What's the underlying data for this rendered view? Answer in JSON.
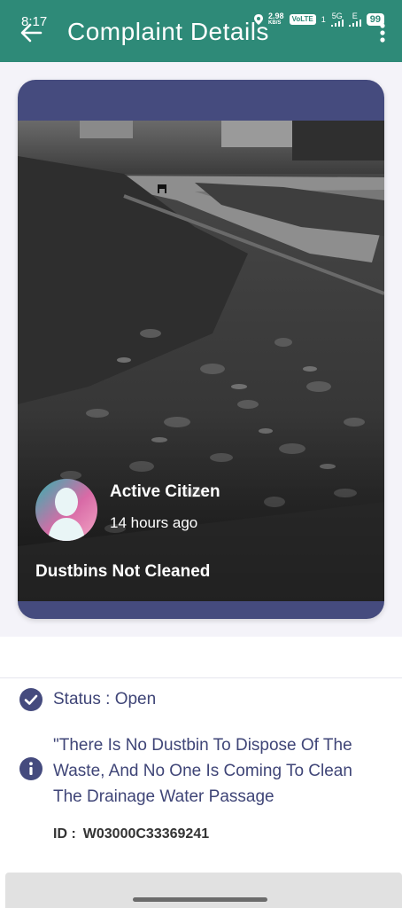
{
  "status_bar": {
    "time": "8:17",
    "speed": "2.98",
    "speed_unit": "KB/S",
    "volte": "VoLTE",
    "sim1": "1",
    "network1": "5G",
    "network2": "E",
    "battery": "99"
  },
  "appbar": {
    "title": "Complaint Details",
    "back_icon": "back-arrow-icon",
    "more_icon": "more-vert-icon",
    "color": "#2e8a78"
  },
  "complaint": {
    "author": "Active Citizen",
    "time_ago": "14 hours ago",
    "title": "Dustbins Not Cleaned",
    "status_label": "Status : Open",
    "description": "\"There Is No Dustbin To Dispose Of The Waste, And No One Is Coming To Clean The Drainage Water Passage",
    "id_label": "ID :",
    "id_value": "W03000C33369241",
    "card_color": "#454b7e"
  }
}
